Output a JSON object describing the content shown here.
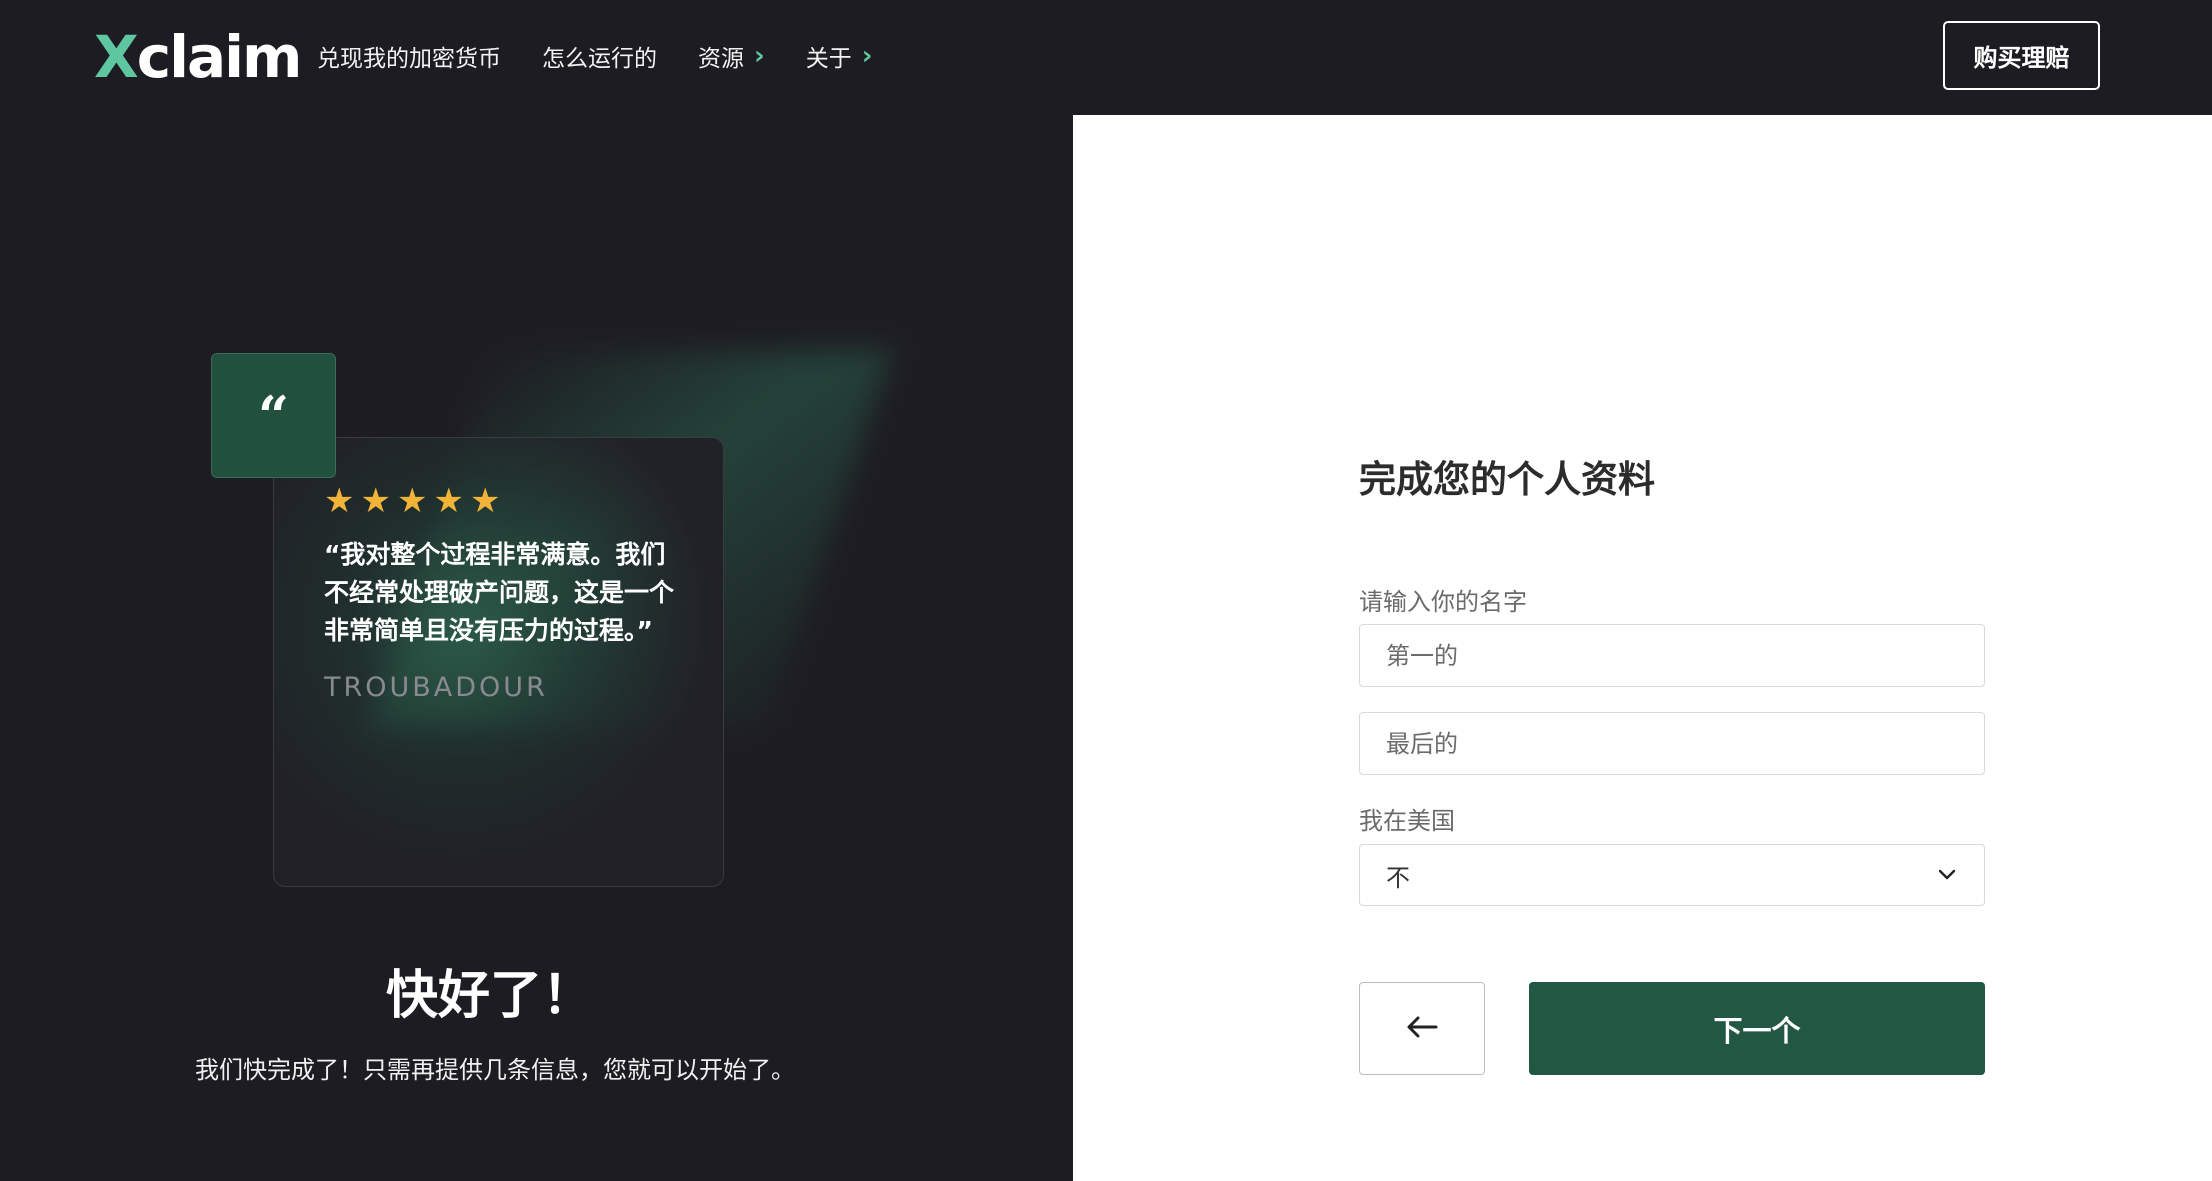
{
  "header": {
    "logo_x": "X",
    "logo_rest": "claim",
    "nav": [
      {
        "label": "兑现我的加密货币"
      },
      {
        "label": "怎么运行的"
      },
      {
        "label": "资源"
      },
      {
        "label": "关于"
      }
    ],
    "buy_button": "购买理赔"
  },
  "testimonial": {
    "quote_mark": "“",
    "rating": 5,
    "stars": [
      "★",
      "★",
      "★",
      "★",
      "★"
    ],
    "text": "“我对整个过程非常满意。我们不经常处理破产问题，这是一个非常简单且没有压力的过程。”",
    "author": "TROUBADOUR"
  },
  "intro": {
    "title": "快好了！",
    "subtitle": "我们快完成了！只需再提供几条信息，您就可以开始了。"
  },
  "form": {
    "title": "完成您的个人资料",
    "name_label": "请输入你的名字",
    "first_placeholder": "第一的",
    "last_placeholder": "最后的",
    "us_label": "我在美国",
    "us_value": "不",
    "next_button": "下一个"
  },
  "colors": {
    "accent": "#5fc7a0",
    "dark_bg": "#1d1c22",
    "primary_button": "#225744",
    "star": "#f2b438"
  }
}
